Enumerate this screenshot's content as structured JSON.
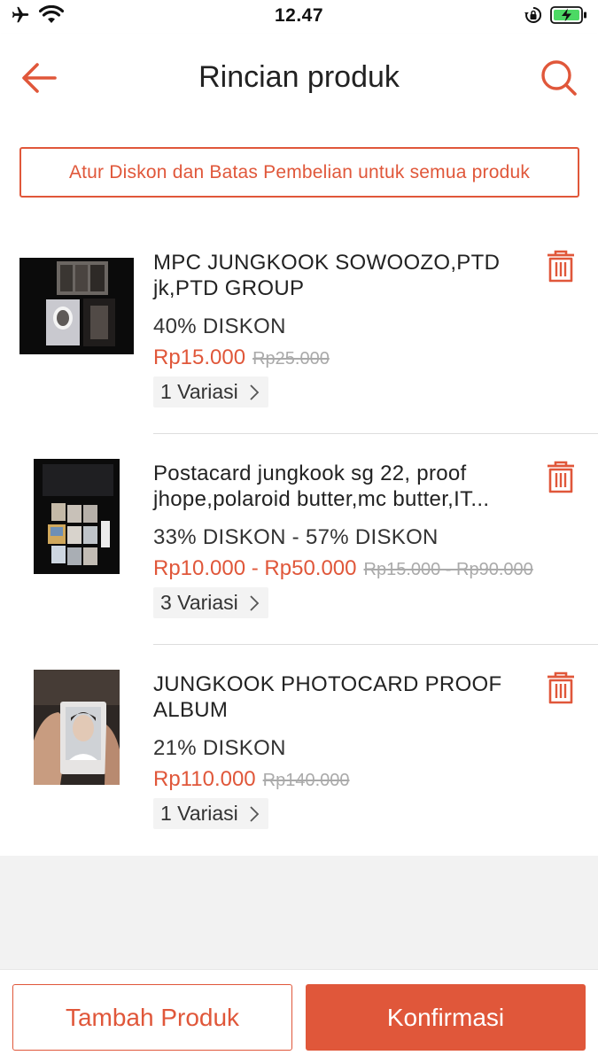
{
  "status_bar": {
    "time": "12.47",
    "icons": [
      "airplane-icon",
      "wifi-icon",
      "orientation-lock-icon",
      "battery-charging-icon"
    ]
  },
  "header": {
    "title": "Rincian produk",
    "back_icon": "arrow-left-icon",
    "search_icon": "search-icon"
  },
  "bulk_action": {
    "label": "Atur Diskon dan Batas Pembelian untuk semua produk"
  },
  "products": [
    {
      "name": "MPC JUNGKOOK SOWOOZO,PTD jk,PTD GROUP",
      "discount": "40% DISKON",
      "price": "Rp15.000",
      "original_price": "Rp25.000",
      "variants": "1 Variasi"
    },
    {
      "name": "Postacard jungkook sg 22, proof jhope,polaroid butter,mc butter,IT...",
      "discount": "33% DISKON - 57% DISKON",
      "price": "Rp10.000 - Rp50.000",
      "original_price": "Rp15.000 - Rp90.000",
      "variants": "3 Variasi"
    },
    {
      "name": "JUNGKOOK PHOTOCARD PROOF ALBUM",
      "discount": "21% DISKON",
      "price": "Rp110.000",
      "original_price": "Rp140.000",
      "variants": "1 Variasi"
    }
  ],
  "footer": {
    "add_label": "Tambah Produk",
    "confirm_label": "Konfirmasi"
  },
  "colors": {
    "accent": "#e0573a",
    "background": "#f2f2f2",
    "text": "#222222",
    "muted": "#aaaaaa"
  }
}
